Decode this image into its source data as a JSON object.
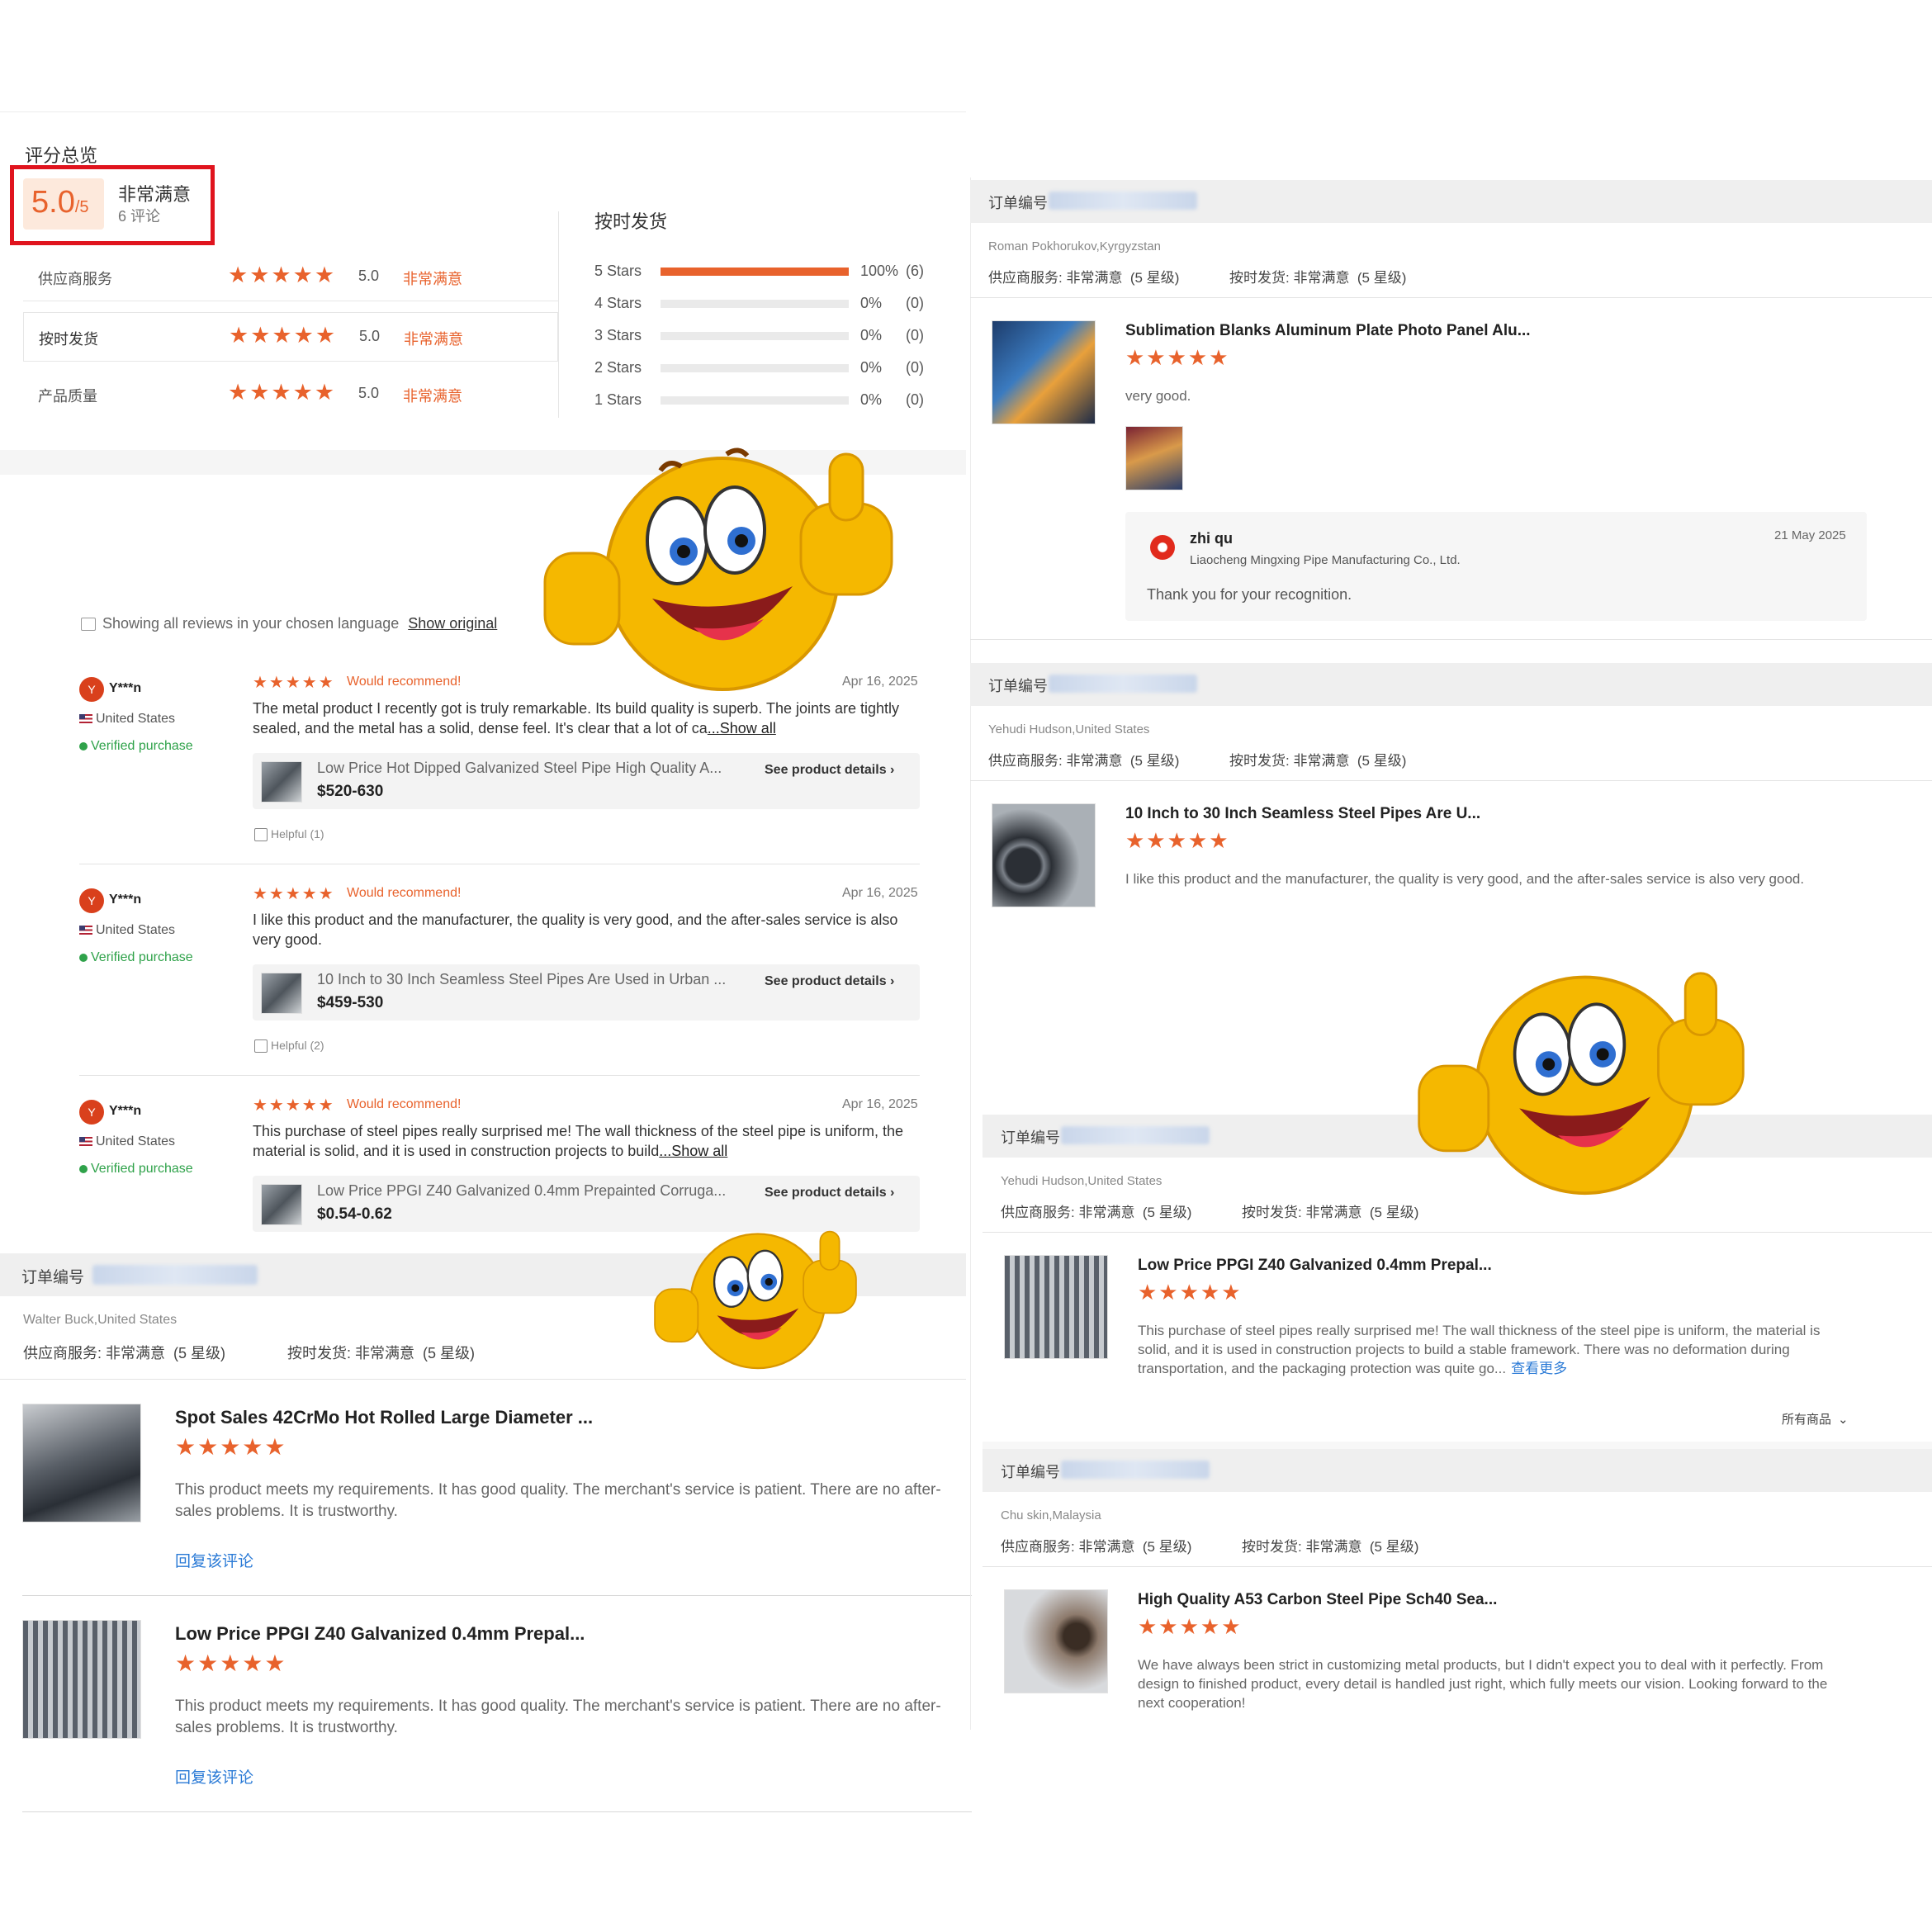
{
  "overview": {
    "title": "评分总览",
    "score": "5.0",
    "score_suffix": "/5",
    "label": "非常满意",
    "review_count": "6 评论",
    "criteria": [
      {
        "name": "供应商服务",
        "stars": "★★★★★",
        "value": "5.0",
        "label": "非常满意"
      },
      {
        "name": "按时发货",
        "stars": "★★★★★",
        "value": "5.0",
        "label": "非常满意"
      },
      {
        "name": "产品质量",
        "stars": "★★★★★",
        "value": "5.0",
        "label": "非常满意"
      }
    ],
    "distribution_title": "按时发货",
    "distribution": [
      {
        "label": "5 Stars",
        "fill": 1.0,
        "pct": "100%",
        "count": "(6)"
      },
      {
        "label": "4 Stars",
        "fill": 0,
        "pct": "0%",
        "count": "(0)"
      },
      {
        "label": "3 Stars",
        "fill": 0,
        "pct": "0%",
        "count": "(0)"
      },
      {
        "label": "2 Stars",
        "fill": 0,
        "pct": "0%",
        "count": "(0)"
      },
      {
        "label": "1 Stars",
        "fill": 0,
        "pct": "0%",
        "count": "(0)"
      }
    ]
  },
  "language_notice": {
    "text": "Showing all reviews in your chosen language",
    "link": "Show original"
  },
  "reviews": [
    {
      "avatar": "Y",
      "user": "Y***n",
      "country": "United States",
      "verified": "Verified purchase",
      "stars": "★★★★★",
      "recommend": "Would recommend!",
      "date": "Apr 16, 2025",
      "text": "The metal product I recently got is truly remarkable. Its build quality is superb. The joints are tightly sealed, and the metal has a solid, dense feel. It's clear that a lot of ca",
      "show_all": "...Show all",
      "product": "Low Price Hot Dipped Galvanized Steel Pipe High Quality A...",
      "price": "$520-630",
      "details": "See product details ›",
      "helpful": "Helpful (1)"
    },
    {
      "avatar": "Y",
      "user": "Y***n",
      "country": "United States",
      "verified": "Verified purchase",
      "stars": "★★★★★",
      "recommend": "Would recommend!",
      "date": "Apr 16, 2025",
      "text": "I like this product and the manufacturer, the quality is very good, and the after-sales service is also very good.",
      "show_all": "",
      "product": "10 Inch to 30 Inch Seamless Steel Pipes Are Used in Urban ...",
      "price": "$459-530",
      "details": "See product details ›",
      "helpful": "Helpful (2)"
    },
    {
      "avatar": "Y",
      "user": "Y***n",
      "country": "United States",
      "verified": "Verified purchase",
      "stars": "★★★★★",
      "recommend": "Would recommend!",
      "date": "Apr 16, 2025",
      "text": "This purchase of steel pipes really surprised me! The wall thickness of the steel pipe is uniform, the material is solid, and it is used in construction projects to build",
      "show_all": "...Show all",
      "product": "Low Price PPGI Z40 Galvanized 0.4mm Prepainted Corruga...",
      "price": "$0.54-0.62",
      "details": "See product details ›",
      "helpful": ""
    }
  ],
  "left_orders": {
    "order_label": "订单编号",
    "buyer": "Walter Buck,United States",
    "service": "供应商服务: 非常满意  (5 星级)",
    "ontime": "按时发货: 非常满意  (5 星级)",
    "items": [
      {
        "title": "Spot Sales 42CrMo Hot Rolled Large Diameter ...",
        "stars": "★★★★★",
        "text": "This product meets my requirements. It has good quality. The merchant's service is patient. There are no after-sales problems. It is trustworthy.",
        "reply": "回复该评论"
      },
      {
        "title": "Low Price PPGI Z40 Galvanized 0.4mm Prepal...",
        "stars": "★★★★★",
        "text": "This product meets my requirements. It has good quality. The merchant's service is patient. There are no after-sales problems. It is trustworthy.",
        "reply": "回复该评论"
      }
    ]
  },
  "right_orders": [
    {
      "order_label": "订单编号",
      "buyer": "Roman Pokhorukov,Kyrgyzstan",
      "service": "供应商服务: 非常满意  (5 星级)",
      "ontime": "按时发货: 非常满意  (5 星级)",
      "title": "Sublimation Blanks Aluminum Plate Photo Panel Alu...",
      "stars": "★★★★★",
      "text": "very good.",
      "reply": {
        "name": "zhi qu",
        "company": "Liaocheng Mingxing Pipe Manufacturing Co., Ltd.",
        "date": "21 May 2025",
        "text": "Thank you for your recognition."
      }
    },
    {
      "order_label": "订单编号",
      "buyer": "Yehudi Hudson,United States",
      "service": "供应商服务: 非常满意  (5 星级)",
      "ontime": "按时发货: 非常满意  (5 星级)",
      "title": "10 Inch to 30 Inch Seamless Steel Pipes Are U...",
      "stars": "★★★★★",
      "text": "I like this product and the manufacturer, the quality is very good, and the after-sales service is also very good."
    },
    {
      "order_label": "订单编号",
      "buyer": "Yehudi Hudson,United States",
      "service": "供应商服务: 非常满意  (5 星级)",
      "ontime": "按时发货: 非常满意  (5 星级)",
      "title": "Low Price PPGI Z40 Galvanized 0.4mm Prepal...",
      "stars": "★★★★★",
      "text": "This purchase of steel pipes really surprised me! The wall thickness of the steel pipe is uniform, the material is solid, and it is used in construction projects to build a stable framework. There was no deformation during transportation, and the packaging protection was quite go...",
      "more": "查看更多",
      "all_products": "所有商品"
    },
    {
      "order_label": "订单编号",
      "buyer": "Chu skin,Malaysia",
      "service": "供应商服务: 非常满意  (5 星级)",
      "ontime": "按时发货: 非常满意  (5 星级)",
      "title": "High Quality A53 Carbon Steel Pipe Sch40 Sea...",
      "stars": "★★★★★",
      "text": "We have always been strict in customizing metal products, but I didn't expect you to deal with it perfectly. From design to finished product, every detail is handled just right, which fully meets our vision. Looking forward to the next cooperation!"
    }
  ],
  "colors": {
    "accent": "#e8622c",
    "highlight_box": "#e0141e",
    "link": "#2a7ad6",
    "emoji": "#f5b800"
  }
}
